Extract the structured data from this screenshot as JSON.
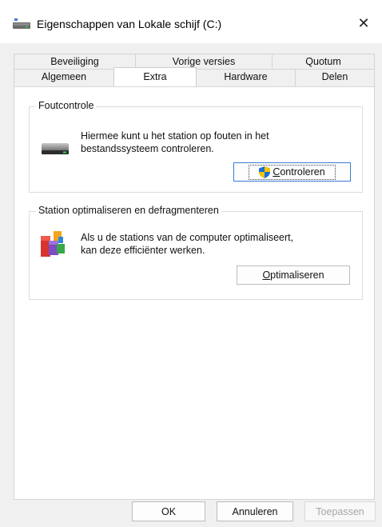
{
  "window": {
    "title": "Eigenschappen van Lokale schijf (C:)",
    "close_glyph": "✕"
  },
  "tabs_row1": [
    {
      "label": "Beveiliging"
    },
    {
      "label": "Vorige versies"
    },
    {
      "label": "Quotum"
    }
  ],
  "tabs_row2": [
    {
      "label": "Algemeen"
    },
    {
      "label": "Extra",
      "selected": true
    },
    {
      "label": "Hardware"
    },
    {
      "label": "Delen"
    }
  ],
  "error_check": {
    "title": "Foutcontrole",
    "description_line1": "Hiermee kunt u het station op fouten in het",
    "description_line2": "bestandssysteem controleren.",
    "button_label_first": "C",
    "button_label_rest": "ontroleren",
    "icon": "hard-drive-icon"
  },
  "optimize": {
    "title": "Station optimaliseren en defragmenteren",
    "description_line1": "Als u de stations van de computer optimaliseert,",
    "description_line2": "kan deze efficiënter werken.",
    "button_label_first": "O",
    "button_label_rest": "ptimaliseren",
    "icon": "defrag-icon"
  },
  "footer": {
    "ok_label": "OK",
    "cancel_label": "Annuleren",
    "apply_label": "Toepassen"
  },
  "colors": {
    "focus_border": "#3a7bd5",
    "shield_blue": "#1e6fd9",
    "shield_yellow": "#f5c400"
  }
}
